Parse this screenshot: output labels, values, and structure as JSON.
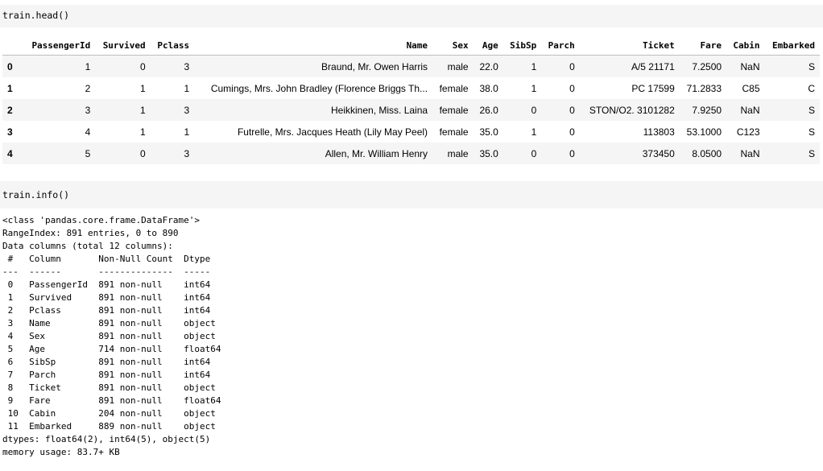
{
  "cells": [
    {
      "code": "train.head()"
    },
    {
      "code": "train.info()"
    }
  ],
  "dataframe": {
    "columns": [
      "",
      "PassengerId",
      "Survived",
      "Pclass",
      "Name",
      "Sex",
      "Age",
      "SibSp",
      "Parch",
      "Ticket",
      "Fare",
      "Cabin",
      "Embarked"
    ],
    "rows": [
      [
        "0",
        "1",
        "0",
        "3",
        "Braund, Mr. Owen Harris",
        "male",
        "22.0",
        "1",
        "0",
        "A/5 21171",
        "7.2500",
        "NaN",
        "S"
      ],
      [
        "1",
        "2",
        "1",
        "1",
        "Cumings, Mrs. John Bradley (Florence Briggs Th...",
        "female",
        "38.0",
        "1",
        "0",
        "PC 17599",
        "71.2833",
        "C85",
        "C"
      ],
      [
        "2",
        "3",
        "1",
        "3",
        "Heikkinen, Miss. Laina",
        "female",
        "26.0",
        "0",
        "0",
        "STON/O2. 3101282",
        "7.9250",
        "NaN",
        "S"
      ],
      [
        "3",
        "4",
        "1",
        "1",
        "Futrelle, Mrs. Jacques Heath (Lily May Peel)",
        "female",
        "35.0",
        "1",
        "0",
        "113803",
        "53.1000",
        "C123",
        "S"
      ],
      [
        "4",
        "5",
        "0",
        "3",
        "Allen, Mr. William Henry",
        "male",
        "35.0",
        "0",
        "0",
        "373450",
        "8.0500",
        "NaN",
        "S"
      ]
    ]
  },
  "info_output": [
    "<class 'pandas.core.frame.DataFrame'>",
    "RangeIndex: 891 entries, 0 to 890",
    "Data columns (total 12 columns):",
    " #   Column       Non-Null Count  Dtype  ",
    "---  ------       --------------  -----  ",
    " 0   PassengerId  891 non-null    int64  ",
    " 1   Survived     891 non-null    int64  ",
    " 2   Pclass       891 non-null    int64  ",
    " 3   Name         891 non-null    object ",
    " 4   Sex          891 non-null    object ",
    " 5   Age          714 non-null    float64",
    " 6   SibSp        891 non-null    int64  ",
    " 7   Parch        891 non-null    int64  ",
    " 8   Ticket       891 non-null    object ",
    " 9   Fare         891 non-null    float64",
    " 10  Cabin        204 non-null    object ",
    " 11  Embarked     889 non-null    object ",
    "dtypes: float64(2), int64(5), object(5)",
    "memory usage: 83.7+ KB"
  ]
}
